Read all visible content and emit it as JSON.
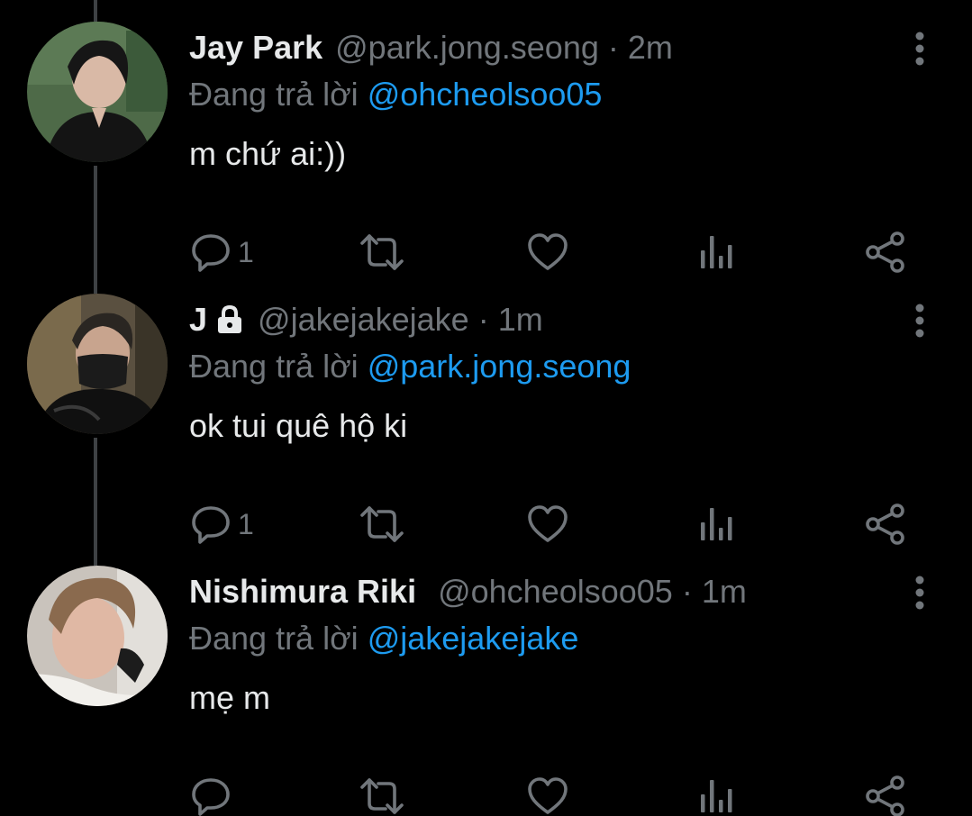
{
  "tweets": [
    {
      "display_name": "Jay Park",
      "handle": "@park.jong.seong",
      "separator": "·",
      "time": "2m",
      "reply_prefix": "Đang trả lời",
      "reply_target": "@ohcheolsoo05",
      "text": "m chứ ai:))",
      "reply_count": "1",
      "protected": false
    },
    {
      "display_name": "J",
      "handle": "@jakejakejake",
      "separator": "·",
      "time": "1m",
      "reply_prefix": "Đang trả lời",
      "reply_target": "@park.jong.seong",
      "text": "ok tui quê hộ ki",
      "reply_count": "1",
      "protected": true
    },
    {
      "display_name": "Nishimura Riki",
      "handle": "@ohcheolsoo05",
      "separator": "·",
      "time": "1m",
      "reply_prefix": "Đang trả lời",
      "reply_target": "@jakejakejake",
      "text": "mẹ m",
      "reply_count": "",
      "protected": false
    }
  ],
  "icons": {
    "reply": "reply-bubble-icon",
    "retweet": "retweet-icon",
    "like": "heart-icon",
    "views": "views-bar-chart-icon",
    "share": "share-icon",
    "more": "more-vertical-icon",
    "lock": "lock-icon"
  },
  "colors": {
    "background": "#000000",
    "text_primary": "#e7e9ea",
    "text_secondary": "#71767b",
    "link": "#1d9bf0",
    "thread_line": "#3e4144"
  }
}
